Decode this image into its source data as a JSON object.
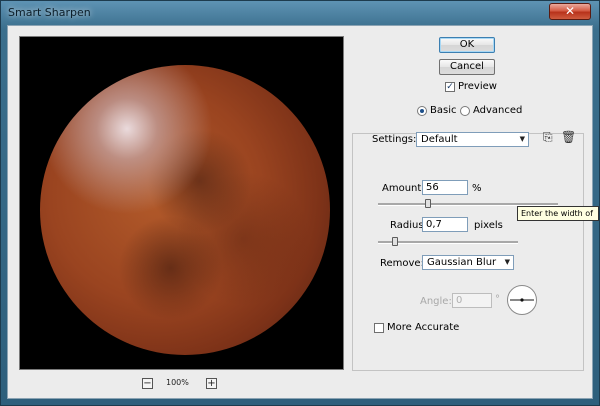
{
  "window": {
    "title": "Smart Sharpen"
  },
  "preview": {
    "zoom": "100%"
  },
  "buttons": {
    "ok": "OK",
    "cancel": "Cancel"
  },
  "preview_toggle": {
    "label": "Preview",
    "checked": true
  },
  "mode": {
    "basic": "Basic",
    "advanced": "Advanced",
    "selected": "basic"
  },
  "settings": {
    "label": "Settings:",
    "value": "Default"
  },
  "amount": {
    "label": "Amount:",
    "value": "56",
    "unit": "%",
    "slider": 0.28
  },
  "radius": {
    "label": "Radius:",
    "value": "0,7",
    "unit": "pixels",
    "slider": 0.12
  },
  "remove": {
    "label": "Remove:",
    "value": "Gaussian Blur"
  },
  "angle": {
    "label": "Angle:",
    "value": "0",
    "unit": "°"
  },
  "more_accurate": {
    "label": "More Accurate",
    "checked": false
  },
  "tooltip": {
    "text": "Enter the width of"
  },
  "icons": {
    "save": "save-settings-icon",
    "delete": "trash-icon"
  }
}
